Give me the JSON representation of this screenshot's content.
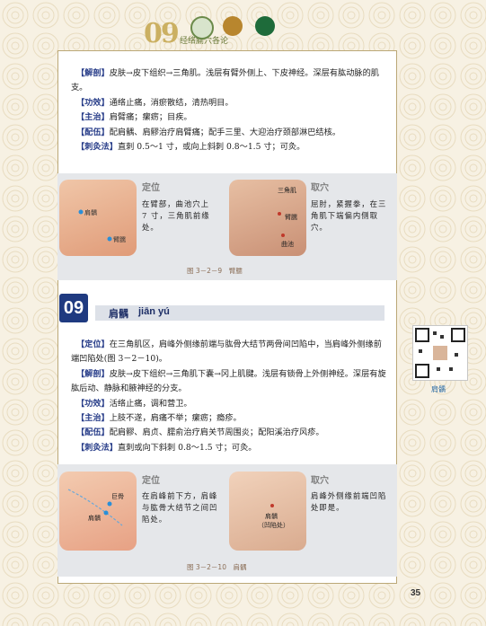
{
  "header": {
    "chapter_number": "09",
    "title": "经络腧穴各论",
    "icons": [
      "book-logo-icon",
      "herb-circle-icon",
      "figure-circle-icon",
      "green-dot-icon"
    ]
  },
  "top_text": [
    {
      "tag": "【解剖】",
      "text": "皮肤→皮下组织→三角肌。浅层有臂外侧上、下皮神经。深层有肱动脉的肌支。"
    },
    {
      "tag": "【功效】",
      "text": "通络止痛，消瘀散结，清热明目。"
    },
    {
      "tag": "【主治】",
      "text": "肩臂痛；瘰疬；目疾。"
    },
    {
      "tag": "【配伍】",
      "text": "配肩髃、肩髎治疗肩臂痛；配手三里、大迎治疗颈部淋巴结核。"
    },
    {
      "tag": "【刺灸法】",
      "text": "直刺 0.5～1 寸，或向上斜刺 0.8～1.5 寸；可灸。"
    }
  ],
  "figure1": {
    "locate_heading": "定位",
    "locate_text": "在臂部，曲池穴上 7 寸，三角肌前缘处。",
    "select_heading": "取穴",
    "select_text": "屈肘，紧握拳，在三角肌下端偏内侧取穴。",
    "photo1_labels": [
      "肩髃",
      "臂臑"
    ],
    "photo2_labels": [
      "三角肌",
      "臂臑",
      "曲池"
    ],
    "caption": "图 3－2－9　臂臑"
  },
  "section": {
    "number": "09",
    "name": "肩髃",
    "pinyin": "jiān yú"
  },
  "bottom_text": [
    {
      "tag": "【定位】",
      "text": "在三角肌区，肩峰外侧缘前端与肱骨大结节两骨间凹陷中，当肩峰外侧缘前端凹陷处(图 3－2－10)。"
    },
    {
      "tag": "【解剖】",
      "text": "皮肤→皮下组织→三角肌下囊→冈上肌腱。浅层有锁骨上外侧神经。深层有旋肱后动、静脉和腋神经的分支。"
    },
    {
      "tag": "【功效】",
      "text": "活络止痛，调和营卫。"
    },
    {
      "tag": "【主治】",
      "text": "上肢不遂，肩痛不举；瘰疬；瘾疹。"
    },
    {
      "tag": "【配伍】",
      "text": "配肩髎、肩贞、臑俞治疗肩关节周围炎；配阳溪治疗风疹。"
    },
    {
      "tag": "【刺灸法】",
      "text": "直刺或向下斜刺 0.8～1.5 寸；可灸。"
    }
  ],
  "figure2": {
    "locate_heading": "定位",
    "locate_text": "在肩峰前下方，肩峰与肱骨大结节之间凹陷处。",
    "select_heading": "取穴",
    "select_text": "肩峰外侧缘前端凹陷处即是。",
    "photo1_labels": [
      "巨骨",
      "肩髃"
    ],
    "photo2_labels": [
      "肩髃",
      "（凹陷处）"
    ],
    "caption": "图 3－2－10　肩髃"
  },
  "qr": {
    "label": "肩髃"
  },
  "page_number": "35",
  "colors": {
    "accent_blue": "#1f3a80",
    "tag_blue": "#2a3f8a",
    "gold": "#cbb062",
    "figure_bg": "#e5e7ea"
  }
}
